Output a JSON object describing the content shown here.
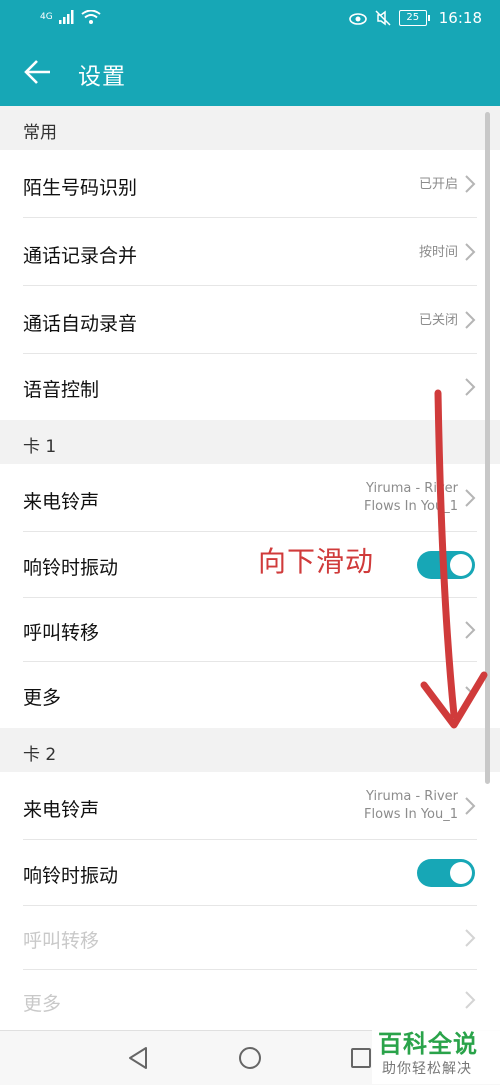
{
  "status_bar": {
    "network": "4G",
    "time": "16:18",
    "battery": "25"
  },
  "app_bar": {
    "title": "设置"
  },
  "sections": [
    {
      "header": "常用",
      "rows": [
        {
          "label": "陌生号码识别",
          "value": "已开启"
        },
        {
          "label": "通话记录合并",
          "value": "按时间"
        },
        {
          "label": "通话自动录音",
          "value": "已关闭"
        },
        {
          "label": "语音控制",
          "value": ""
        }
      ]
    },
    {
      "header": "卡 1",
      "rows": [
        {
          "label": "来电铃声",
          "value_line1": "Yiruma - River",
          "value_line2": "Flows In You_1"
        },
        {
          "label": "响铃时振动",
          "toggle_on": true
        },
        {
          "label": "呼叫转移"
        },
        {
          "label": "更多"
        }
      ]
    },
    {
      "header": "卡 2",
      "rows": [
        {
          "label": "来电铃声",
          "value_line1": "Yiruma - River",
          "value_line2": "Flows In You_1"
        },
        {
          "label": "响铃时振动",
          "toggle_on": true
        },
        {
          "label": "呼叫转移",
          "disabled": true
        },
        {
          "label": "更多",
          "disabled": true
        }
      ]
    }
  ],
  "annotation": {
    "text": "向下滑动",
    "color": "#d03b3b"
  },
  "watermark": {
    "title": "百科全说",
    "subtitle": "助你轻松解决"
  },
  "colors": {
    "accent": "#17a7b6"
  }
}
